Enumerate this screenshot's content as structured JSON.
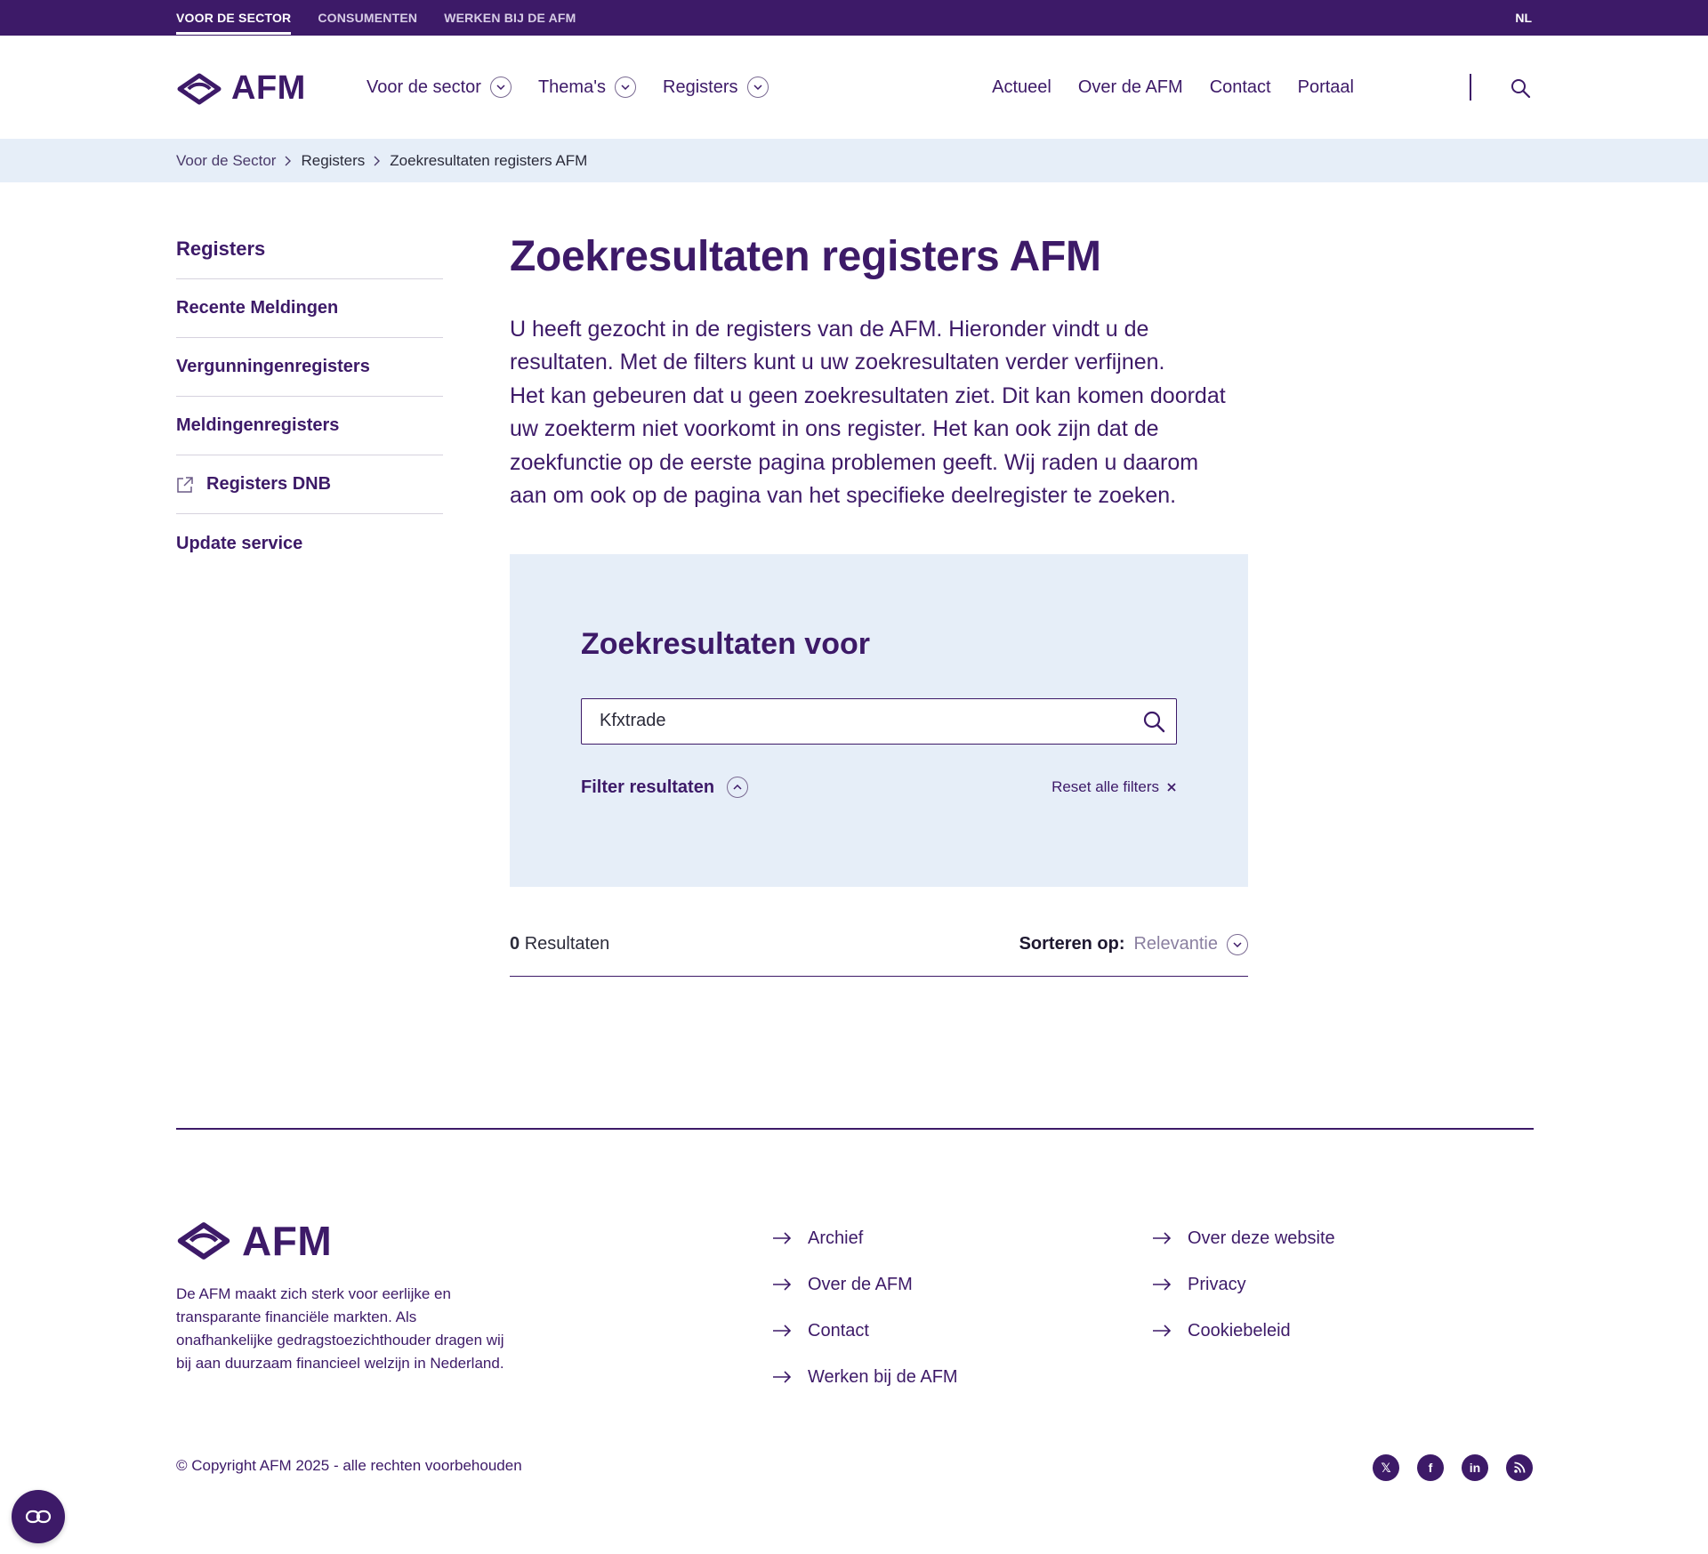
{
  "colors": {
    "brand_purple": "#3d1a68",
    "breadcrumb_bg": "#e6eef8",
    "panel_bg": "#e6eef8",
    "muted_text": "#8a7fa0"
  },
  "topbar": {
    "links": [
      {
        "label": "VOOR DE SECTOR",
        "active": true
      },
      {
        "label": "CONSUMENTEN",
        "active": false
      },
      {
        "label": "WERKEN BIJ DE AFM",
        "active": false
      }
    ],
    "language": "NL"
  },
  "header": {
    "logo_text": "AFM",
    "main_nav": [
      {
        "label": "Voor de sector",
        "icon": "chevron-down-icon"
      },
      {
        "label": "Thema's",
        "icon": "chevron-down-icon"
      },
      {
        "label": "Registers",
        "icon": "chevron-down-icon"
      }
    ],
    "right_nav": [
      "Actueel",
      "Over de AFM",
      "Contact",
      "Portaal"
    ],
    "search_icon": "search-icon"
  },
  "breadcrumb": [
    "Voor de Sector",
    "Registers",
    "Zoekresultaten registers AFM"
  ],
  "sidebar": {
    "title": "Registers",
    "items": [
      {
        "label": "Recente Meldingen",
        "external": false
      },
      {
        "label": "Vergunningenregisters",
        "external": false
      },
      {
        "label": "Meldingenregisters",
        "external": false
      },
      {
        "label": "Registers DNB",
        "external": true,
        "icon": "external-link-icon"
      },
      {
        "label": "Update service",
        "external": false
      }
    ]
  },
  "main": {
    "title": "Zoekresultaten registers AFM",
    "intro_lines": [
      "U heeft gezocht in de registers van de AFM. Hieronder vindt u de",
      "resultaten. Met de filters kunt u uw zoekresultaten verder verfijnen.",
      "Het kan gebeuren dat u geen zoekresultaten ziet. Dit kan komen doordat",
      "uw zoekterm niet voorkomt in ons register. Het kan ook zijn dat de",
      "zoekfunctie op de eerste pagina problemen geeft. Wij raden u daarom",
      "aan om ook op de pagina van het specifieke deelregister te zoeken."
    ]
  },
  "search_panel": {
    "title": "Zoekresultaten voor",
    "query_value": "Kfxtrade",
    "filter_label": "Filter resultaten",
    "reset_label": "Reset alle filters"
  },
  "results": {
    "count": "0",
    "count_label": "Resultaten",
    "sort_label": "Sorteren op:",
    "sort_value": "Relevantie"
  },
  "footer": {
    "logo_text": "AFM",
    "description": "De AFM maakt zich sterk voor eerlijke en transparante financiële markten. Als onafhankelijke gedragstoezichthouder dragen wij bij aan duurzaam financieel welzijn in Nederland.",
    "links_col1": [
      "Archief",
      "Over de AFM",
      "Contact",
      "Werken bij de AFM"
    ],
    "links_col2": [
      "Over deze website",
      "Privacy",
      "Cookiebeleid"
    ],
    "copyright": "© Copyright AFM 2025 - alle rechten voorbehouden",
    "social": [
      {
        "name": "x-icon",
        "glyph": "𝕏"
      },
      {
        "name": "facebook-icon",
        "glyph": "f"
      },
      {
        "name": "linkedin-icon",
        "glyph": "in"
      },
      {
        "name": "rss-icon",
        "glyph": "◉"
      }
    ]
  }
}
